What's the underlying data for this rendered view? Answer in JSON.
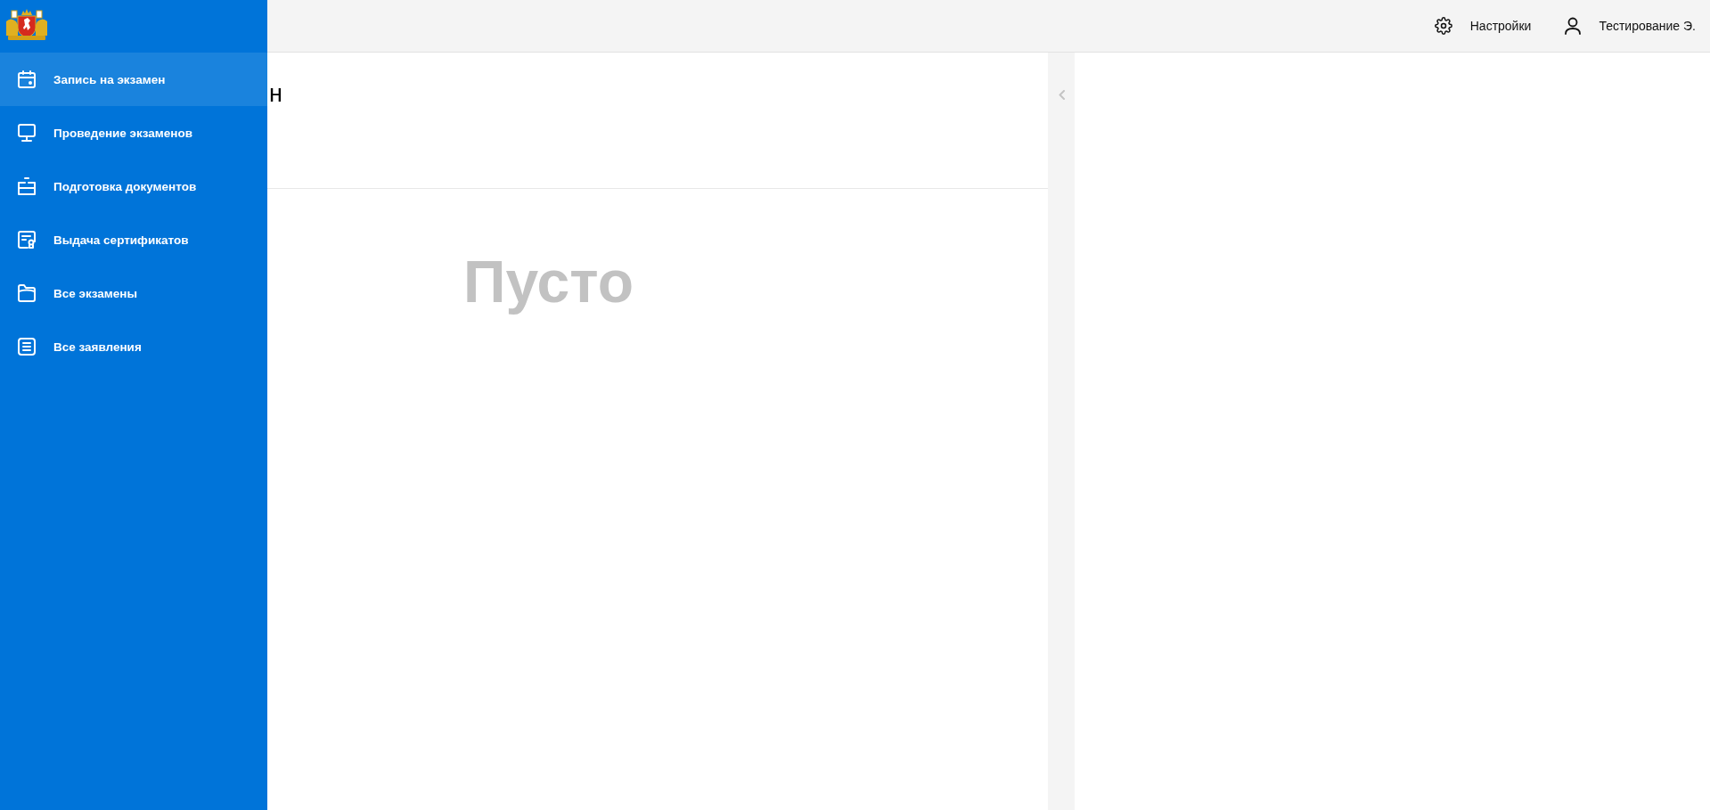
{
  "sidebar": {
    "items": [
      {
        "label": "Запись на экзамен",
        "selected": true
      },
      {
        "label": "Проведение экзаменов",
        "selected": false
      },
      {
        "label": "Подготовка документов",
        "selected": false
      },
      {
        "label": "Выдача сертификатов",
        "selected": false
      },
      {
        "label": "Все экзамены",
        "selected": false
      },
      {
        "label": "Все заявления",
        "selected": false
      }
    ]
  },
  "top_bar": {
    "settings": {
      "label": "Настройки"
    },
    "user": {
      "label": "Тестирование Э."
    }
  },
  "content": {
    "title": "н",
    "empty_text": "Пусто"
  }
}
